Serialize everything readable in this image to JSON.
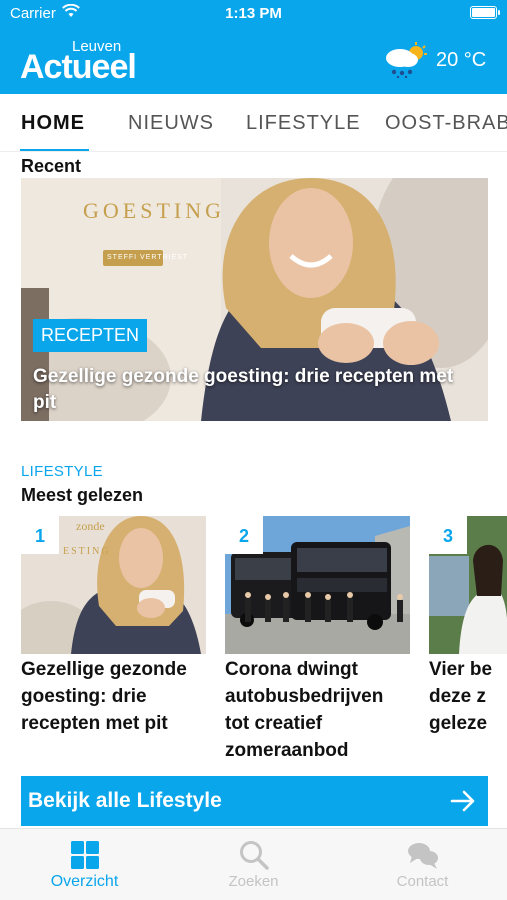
{
  "status_bar": {
    "carrier": "Carrier",
    "time": "1:13 PM"
  },
  "header": {
    "logo_small": "Leuven",
    "logo_big": "Actueel",
    "weather_icon": "cloud-sun-rain-icon",
    "temperature": "20 °C"
  },
  "tabs": [
    {
      "label": "HOME",
      "active": true
    },
    {
      "label": "NIEUWS",
      "active": false
    },
    {
      "label": "LIFESTYLE",
      "active": false
    },
    {
      "label": "OOST-BRABANT",
      "active": false
    }
  ],
  "recent": {
    "title": "Recent",
    "hero": {
      "image_text": "GOESTING",
      "image_subtext": "STEFFI VERTRIEST",
      "badge": "RECEPTEN",
      "headline": "Gezellige gezonde goesting: drie recepten met pit"
    }
  },
  "most_read": {
    "kicker": "LIFESTYLE",
    "title": "Meest gelezen",
    "cards": [
      {
        "rank": "1",
        "title": "Gezellige gezonde goesting: drie recepten met pit"
      },
      {
        "rank": "2",
        "title": "Corona dwingt autobusbedrijven tot creatief zomeraanbod"
      },
      {
        "rank": "3",
        "title": "Vier be deze z geleze"
      }
    ]
  },
  "cta": {
    "label": "Bekijk alle Lifestyle",
    "icon": "arrow-right-icon"
  },
  "bottom_nav": [
    {
      "label": "Overzicht",
      "icon": "grid-icon",
      "active": true
    },
    {
      "label": "Zoeken",
      "icon": "search-icon",
      "active": false
    },
    {
      "label": "Contact",
      "icon": "chat-bubbles-icon",
      "active": false
    }
  ],
  "colors": {
    "accent": "#0aa6eb",
    "inactive": "#c4c4c4"
  }
}
